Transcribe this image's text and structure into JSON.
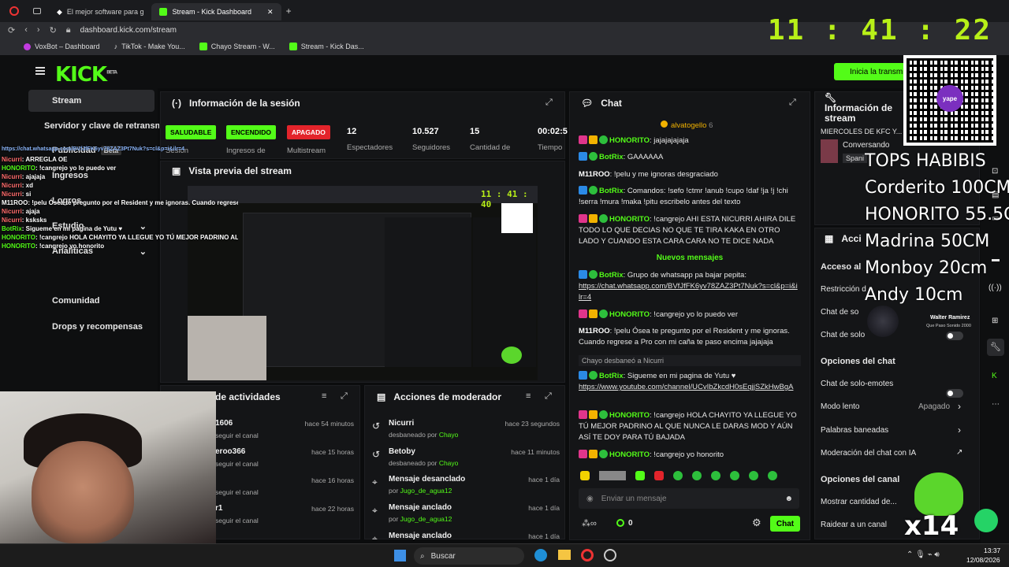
{
  "browser": {
    "tabs": [
      "El mejor software para g",
      "Stream - Kick Dashboard"
    ],
    "url": "dashboard.kick.com/stream",
    "bookmarks": [
      "VoxBot – Dashboard",
      "TikTok - Make You...",
      "Chayo Stream - W...",
      "Stream - Kick Das..."
    ]
  },
  "clock": "11 : 41 : 22",
  "header": {
    "logo": "KICK",
    "beta": "BETA",
    "go_live": "Inicia la transmi"
  },
  "sidebar": {
    "items": [
      {
        "label": "Stream"
      },
      {
        "label": "Servidor y clave de retransm"
      },
      {
        "label": "Publicidad",
        "badge": "Beta"
      },
      {
        "label": "Ingresos"
      },
      {
        "label": "Logros"
      },
      {
        "label": "Estudio"
      },
      {
        "label": "Analíticas"
      },
      {
        "label": "Comunidad"
      },
      {
        "label": "Drops y recompensas"
      }
    ]
  },
  "session": {
    "title": "Información de la sesión",
    "badges": [
      "SALUDABLE",
      "ENCENDIDO",
      "APAGADO"
    ],
    "badge_labels": [
      "Sesión",
      "Ingresos de",
      "Multistream"
    ],
    "stats": [
      {
        "value": "12",
        "label": "Espectadores"
      },
      {
        "value": "10.527",
        "label": "Seguidores"
      },
      {
        "value": "15",
        "label": "Cantidad de"
      },
      {
        "value": "00:02:5",
        "label": "Tiempo"
      }
    ]
  },
  "preview": {
    "title": "Vista previa del stream",
    "clock": "11 : 41 : 40"
  },
  "activity": {
    "title": "de actividades",
    "items": [
      {
        "name": "1606",
        "sub": "seguir el canal",
        "time": "hace 54 minutos"
      },
      {
        "name": "eroo366",
        "sub": "seguir el canal",
        "time": "hace 15 horas"
      },
      {
        "name": "",
        "sub": "seguir el canal",
        "time": "hace 16 horas"
      },
      {
        "name": "r1",
        "sub": "seguir el canal",
        "time": "hace 22 horas"
      }
    ]
  },
  "mod": {
    "title": "Acciones de moderador",
    "items": [
      {
        "name": "Nicurri",
        "sub": "desbaneado por ",
        "by": "Chayo",
        "time": "hace 23 segundos"
      },
      {
        "name": "Betoby",
        "sub": "desbaneado por ",
        "by": "Chayo",
        "time": "hace 11 minutos"
      },
      {
        "name": "Mensaje desanclado",
        "sub": "por ",
        "by": "Jugo_de_agua12",
        "time": "hace 1 día"
      },
      {
        "name": "Mensaje anclado",
        "sub": "por ",
        "by": "Jugo_de_agua12",
        "time": "hace 1 día"
      },
      {
        "name": "Mensaje anclado",
        "sub": "",
        "by": "",
        "time": "hace 1 día"
      }
    ]
  },
  "chat": {
    "title": "Chat",
    "pinned": "alvatogello",
    "pinned_count": "6",
    "new_messages": "Nuevos mensajes",
    "unban": "Chayo desbaneó a Nicurri",
    "input_placeholder": "Enviar un mensaje",
    "send": "Chat",
    "points": "0",
    "messages": [
      {
        "user": "HONORITO",
        "text": ": jajajajajaja"
      },
      {
        "user": "BotRix",
        "text": ": GAAAAAA"
      },
      {
        "user": "M11ROO",
        "text": ": !pelu y me ignoras desgraciado"
      },
      {
        "user": "BotRix",
        "text": ": Comandos: !sefo !ctmr !anub !cupo !daf !ja !j !chi !serra !mura !maka !pitu escribelo antes del texto"
      },
      {
        "user": "HONORITO",
        "text": ": !cangrejo AHI ESTA NICURRI AHIRA DILE TODO LO QUE DECIAS NO QUE TE TIRA KAKA EN OTRO LADO Y CUANDO ESTA CARA CARA NO TE DICE NADA"
      },
      {
        "user": "BotRix",
        "text": ": Grupo de whatsapp pa bajar pepita:",
        "link": "https://chat.whatsapp.com/BVfJfFK6yv78ZAZ3Pt7Nuk?s=cl&p=i&ilr=4"
      },
      {
        "user": "HONORITO",
        "text": ": !cangrejo yo lo puedo ver"
      },
      {
        "user": "M11ROO",
        "text": ": !pelu Ósea te pregunto por el Resident y me ignoras. Cuando regrese a Pro con mi caña te paso encima jajajaja"
      },
      {
        "user": "BotRix",
        "text": ": Sigueme en mi pagina de Yutu ♥",
        "link": "https://www.youtube.com/channel/UCvIbZkcdH0sEqjjSZkHwBgA"
      },
      {
        "user": "HONORITO",
        "text": ": !cangrejo HOLA CHAYITO YA LLEGUE YO TÚ MEJOR PADRINO AL QUE NUNCA LE DARAS MOD Y AÚN ASÍ TE DOY PARA TÚ BAJADA"
      },
      {
        "user": "HONORITO",
        "text": ": !cangrejo yo honorito"
      }
    ]
  },
  "stream_info": {
    "title": "Información de stream",
    "stream_title": "MIERCOLES DE KFC Y...",
    "category": "Conversando",
    "lang": "Spani"
  },
  "mod_panel": {
    "title": "Acci",
    "access": "Acceso al",
    "restriction": "Restricción d",
    "chat_so": "Chat de so",
    "chat_solo": "Chat de solo",
    "options_title": "Opciones del chat",
    "emotes": "Chat de solo-emotes",
    "slow": "Modo lento",
    "slow_value": "Apagado",
    "banned": "Palabras baneadas",
    "ai": "Moderación del chat con IA",
    "channel_title": "Opciones del canal",
    "show_count": "Mostrar cantidad de...",
    "raid": "Raidear a un canal"
  },
  "overlay": {
    "tops": [
      "TOPS HABIBIS",
      "Corderito 100CM",
      "HONORITO 55.5C",
      "Madrina 50CM",
      "Monboy 20cm",
      "Andy 10cm"
    ],
    "x14": "x14",
    "yape": "yape",
    "walter": "Walter Ramirez",
    "walter_sub": "Que Paso Sonido 2000",
    "chat": [
      {
        "n": "Nicurri",
        "t": ": ARREGLA OE",
        "c": "n"
      },
      {
        "n": "HONORITO",
        "t": ": !cangrejo yo lo puedo ver",
        "c": "h"
      },
      {
        "n": "Nicurri",
        "t": ": ajajaja",
        "c": "n"
      },
      {
        "n": "Nicurri",
        "t": ": xd",
        "c": "n"
      },
      {
        "n": "Nicurri",
        "t": ": si",
        "c": "n"
      },
      {
        "n": "M11ROO",
        "t": ": !pelu Ósea te pregunto por el Resident y me ignoras. Cuando regrese a Pro con mi caña te paso encima jajajaja",
        "c": "w"
      },
      {
        "n": "Nicurri",
        "t": ": ajaja",
        "c": "n"
      },
      {
        "n": "Nicurri",
        "t": ": ksksks",
        "c": "n"
      },
      {
        "n": "BotRix",
        "t": ": Sigueme en mi pagina de Yutu ♥",
        "c": "h"
      },
      {
        "n": "HONORITO",
        "t": ": !cangrejo HOLA CHAYITO YA LLEGUE YO TÚ MEJOR PADRINO AL QUE NUNCA LE DARAS MOD Y AÚN ASÍ TE DOY PARA TÚ BAJADA",
        "c": "h"
      },
      {
        "n": "HONORITO",
        "t": ": !cangrejo yo honorito",
        "c": "h"
      }
    ]
  },
  "taskbar": {
    "search": "Buscar",
    "time": "13:37",
    "date": "12/08/2026"
  }
}
